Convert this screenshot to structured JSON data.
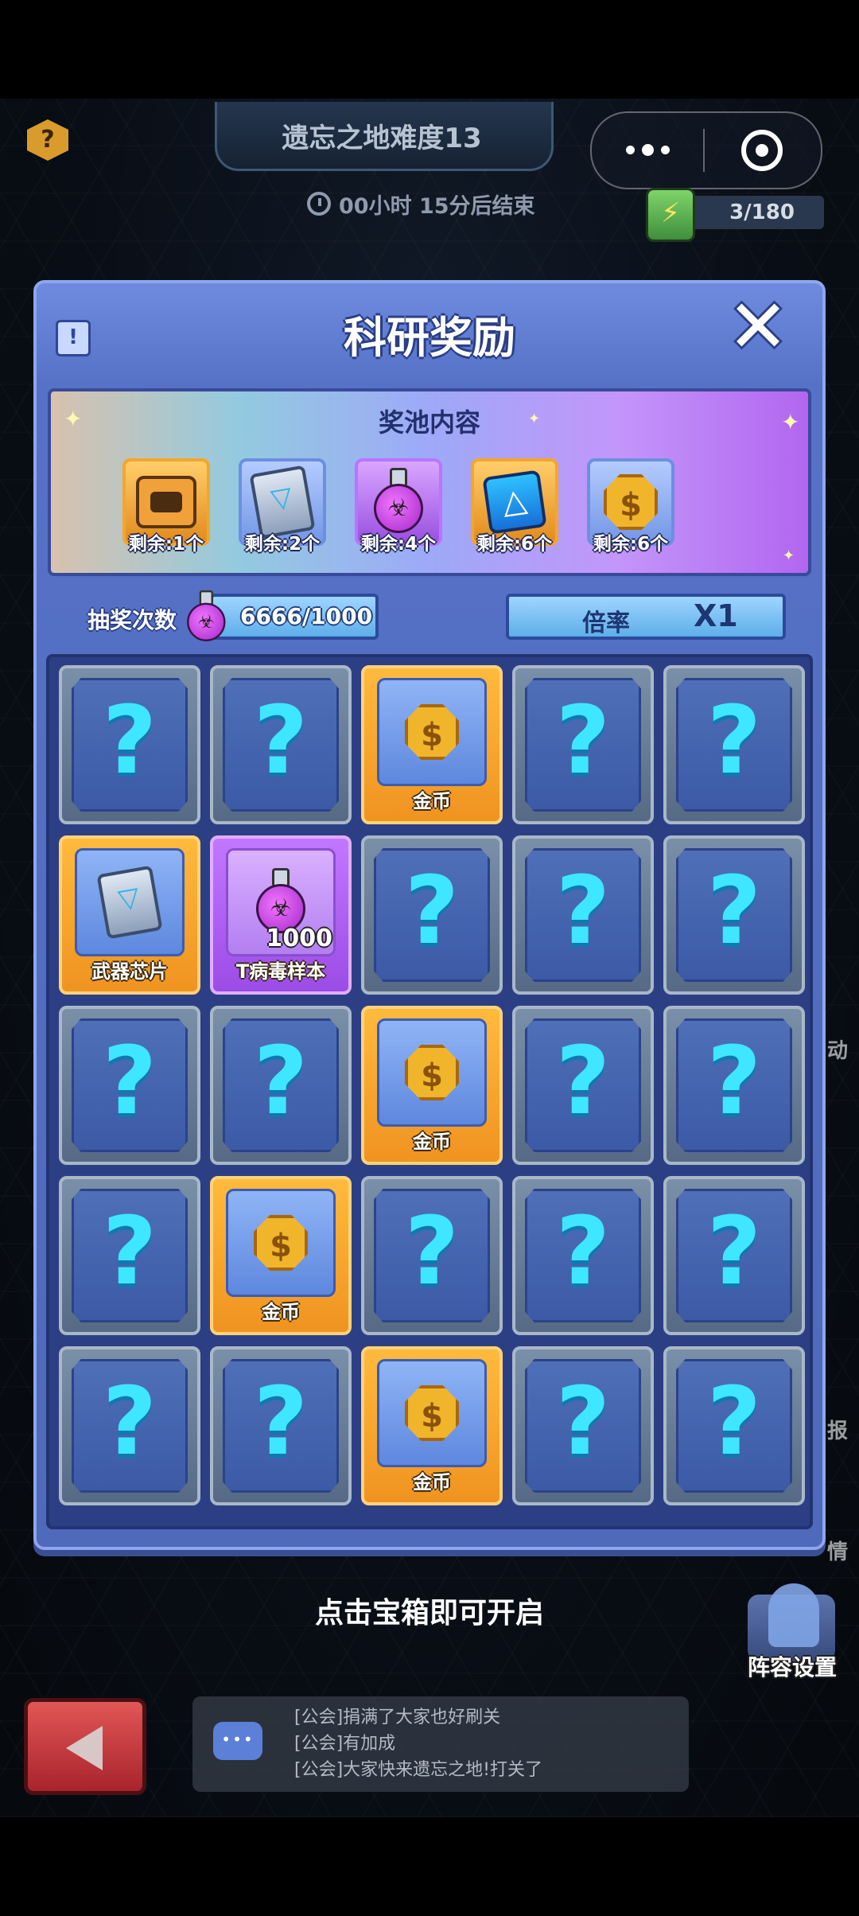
{
  "hud": {
    "stage_title": "遗忘之地难度13",
    "timer": "00小时 15分后结束",
    "energy": "3/180",
    "help_icon": "?"
  },
  "panel": {
    "title": "科研奖励",
    "info_icon": "!",
    "close_icon": "✕"
  },
  "pool": {
    "title": "奖池内容",
    "items": [
      {
        "icon": "supply-bag-icon",
        "remaining": "剩余:1个"
      },
      {
        "icon": "weapon-chip-icon",
        "remaining": "剩余:2个"
      },
      {
        "icon": "virus-sample-icon",
        "remaining": "剩余:4个"
      },
      {
        "icon": "module-icon",
        "remaining": "剩余:6个"
      },
      {
        "icon": "gold-coin-icon",
        "remaining": "剩余:6个"
      }
    ]
  },
  "draw": {
    "label": "抽奖次数",
    "count": "6666/1000",
    "rate_label": "倍率",
    "rate_value": "X1"
  },
  "grid": {
    "cards": [
      {
        "state": "hidden"
      },
      {
        "state": "hidden"
      },
      {
        "state": "coin",
        "label": "金币"
      },
      {
        "state": "hidden"
      },
      {
        "state": "hidden"
      },
      {
        "state": "chip",
        "label": "武器芯片"
      },
      {
        "state": "potion",
        "label": "T病毒样本",
        "qty": "1000"
      },
      {
        "state": "hidden"
      },
      {
        "state": "hidden"
      },
      {
        "state": "hidden"
      },
      {
        "state": "hidden"
      },
      {
        "state": "hidden"
      },
      {
        "state": "coin",
        "label": "金币"
      },
      {
        "state": "hidden"
      },
      {
        "state": "hidden"
      },
      {
        "state": "hidden"
      },
      {
        "state": "coin",
        "label": "金币"
      },
      {
        "state": "hidden"
      },
      {
        "state": "hidden"
      },
      {
        "state": "hidden"
      },
      {
        "state": "hidden"
      },
      {
        "state": "hidden"
      },
      {
        "state": "coin",
        "label": "金币"
      },
      {
        "state": "hidden"
      },
      {
        "state": "hidden"
      }
    ]
  },
  "hint": "点击宝箱即可开启",
  "chat": {
    "icon": "•••",
    "lines": [
      "[公会]捐满了大家也好刷关",
      "[公会]有加成",
      "[公会]大家快来遗忘之地!打关了"
    ]
  },
  "lineup_label": "阵容设置",
  "side_texts": [
    "动",
    "报",
    "情"
  ],
  "colors": {
    "panel": "#5672c6",
    "accent_orange": "#f09320",
    "accent_purple": "#9b4ce6",
    "question_cyan": "#3ee7ff"
  }
}
